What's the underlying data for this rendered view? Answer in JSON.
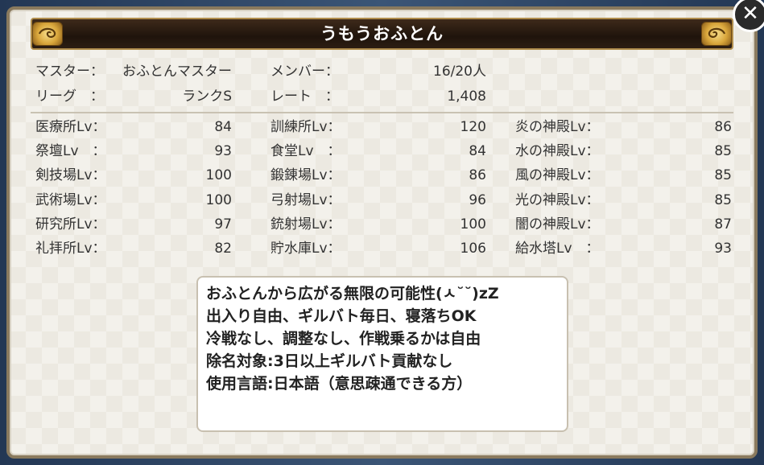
{
  "guild": {
    "name": "うもうおふとん"
  },
  "info": {
    "master_label": "マスター：",
    "master_value": "おふとんマスター",
    "members_label": "メンバー：",
    "members_value": "16/20人",
    "league_label": "リーグ　：",
    "league_value": "ランクS",
    "rate_label": "レート　：",
    "rate_value": "1,408"
  },
  "facilities": {
    "col1": [
      {
        "label": "医療所Lv：",
        "value": "84"
      },
      {
        "label": "祭壇Lv　：",
        "value": "93"
      },
      {
        "label": "剣技場Lv：",
        "value": "100"
      },
      {
        "label": "武術場Lv：",
        "value": "100"
      },
      {
        "label": "研究所Lv：",
        "value": "97"
      },
      {
        "label": "礼拝所Lv：",
        "value": "82"
      }
    ],
    "col2": [
      {
        "label": "訓練所Lv：",
        "value": "120"
      },
      {
        "label": "食堂Lv　：",
        "value": "84"
      },
      {
        "label": "鍛錬場Lv：",
        "value": "86"
      },
      {
        "label": "弓射場Lv：",
        "value": "96"
      },
      {
        "label": "銃射場Lv：",
        "value": "100"
      },
      {
        "label": "貯水庫Lv：",
        "value": "106"
      }
    ],
    "col3": [
      {
        "label": "炎の神殿Lv：",
        "value": "86"
      },
      {
        "label": "水の神殿Lv：",
        "value": "85"
      },
      {
        "label": "風の神殿Lv：",
        "value": "85"
      },
      {
        "label": "光の神殿Lv：",
        "value": "85"
      },
      {
        "label": "闇の神殿Lv：",
        "value": "87"
      },
      {
        "label": "給水塔Lv　：",
        "value": "93"
      }
    ]
  },
  "message": {
    "lines": [
      "おふとんから広がる無限の可能性(ㅅ˘˘)zZ",
      "出入り自由、ギルバト毎日、寝落ちOK",
      "冷戦なし、調整なし、作戦乗るかは自由",
      "除名対象:3日以上ギルバト貢献なし",
      "使用言語:日本語（意思疎通できる方）"
    ]
  },
  "close_label": "✕"
}
